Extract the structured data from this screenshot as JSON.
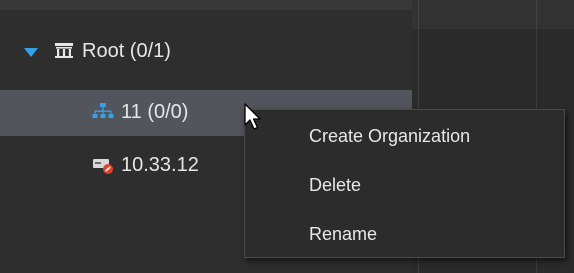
{
  "tree": {
    "root": {
      "label": "Root (0/1)",
      "expanded": true,
      "icon": "building-icon"
    },
    "org": {
      "label": "11 (0/0)",
      "selected": true,
      "icon": "organization-icon"
    },
    "device": {
      "label": "10.33.12",
      "status": "offline",
      "icon": "device-offline-icon"
    }
  },
  "context_menu": {
    "items": [
      "Create Organization",
      "Delete",
      "Rename"
    ]
  },
  "colors": {
    "accent": "#2fa3e6",
    "selected_row": "#52555b",
    "offline_badge": "#e0452c"
  }
}
